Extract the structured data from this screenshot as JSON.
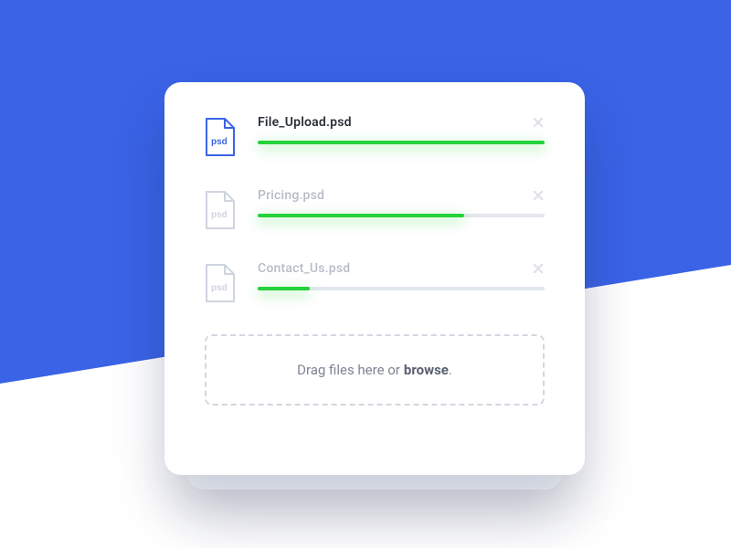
{
  "colors": {
    "brand_blue": "#3a63e6",
    "progress_green": "#25d23a",
    "muted": "#b6bcc7",
    "text": "#2b2f38"
  },
  "files": [
    {
      "name": "File_Upload.psd",
      "ext_label": "psd",
      "progress": 100,
      "active": true
    },
    {
      "name": "Pricing.psd",
      "ext_label": "psd",
      "progress": 72,
      "active": false
    },
    {
      "name": "Contact_Us.psd",
      "ext_label": "psd",
      "progress": 18,
      "active": false
    }
  ],
  "dropzone": {
    "text": "Drag files here or",
    "action": "browse",
    "suffix": "."
  }
}
